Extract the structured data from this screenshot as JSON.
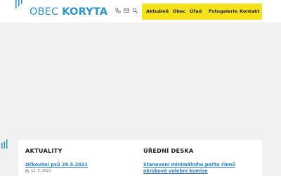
{
  "header": {
    "logo_prefix": "OBEC",
    "logo_name": "KORYTA",
    "icons": [
      "phone-icon",
      "mail-icon",
      "search-icon"
    ],
    "nav": [
      "Aktuálně",
      "Obec",
      "Úřad",
      "Fotogalerie",
      "Kontakt"
    ],
    "accent_color": "#f6e21c",
    "brand_color": "#2a93d5"
  },
  "news": {
    "title": "AKTUALITY",
    "items": [
      {
        "title": "Očkování psů 29.5.2021",
        "date": "12. 5. 2021"
      }
    ]
  },
  "board": {
    "title": "ÚŘEDNÍ DESKA",
    "items": [
      {
        "title": "Stanovení minimálního počtu členů okrskové volební komise"
      }
    ]
  }
}
